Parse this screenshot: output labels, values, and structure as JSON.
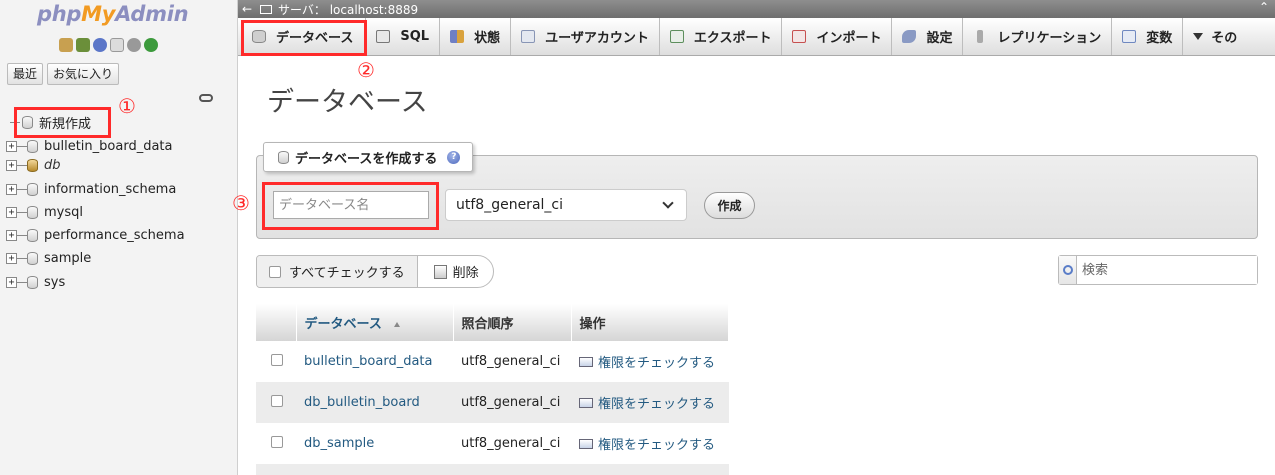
{
  "nav": {
    "logo": {
      "php": "php",
      "my": "My",
      "admin": "Admin"
    },
    "icons": [
      "home-icon",
      "logout-icon",
      "help-icon",
      "docs-icon",
      "settings-icon",
      "reload-icon"
    ],
    "tabs": {
      "recent": "最近",
      "favorites": "お気に入り"
    },
    "new_item": "新規作成",
    "databases": [
      {
        "name": "bulletin_board_data",
        "italic": false
      },
      {
        "name": "db",
        "italic": true
      },
      {
        "name": "information_schema",
        "italic": false
      },
      {
        "name": "mysql",
        "italic": false
      },
      {
        "name": "performance_schema",
        "italic": false
      },
      {
        "name": "sample",
        "italic": false
      },
      {
        "name": "sys",
        "italic": false
      }
    ]
  },
  "topbar": {
    "back": "←",
    "server_label": "サーバ： localhost:8889",
    "collapse": "⌃"
  },
  "menu": [
    {
      "label": "データベース",
      "icon": "database-icon",
      "color": "#c9c9c9"
    },
    {
      "label": "SQL",
      "icon": "sql-icon",
      "color": "#c9c9c9"
    },
    {
      "label": "状態",
      "icon": "status-icon",
      "color": "#7a87c8"
    },
    {
      "label": "ユーザアカウント",
      "icon": "users-icon",
      "color": "#9aa7c7"
    },
    {
      "label": "エクスポート",
      "icon": "export-icon",
      "color": "#5d8f5d"
    },
    {
      "label": "インポート",
      "icon": "import-icon",
      "color": "#c65050"
    },
    {
      "label": "設定",
      "icon": "wrench-icon",
      "color": "#7a8ab8"
    },
    {
      "label": "レプリケーション",
      "icon": "replication-icon",
      "color": "#999999"
    },
    {
      "label": "変数",
      "icon": "variables-icon",
      "color": "#6f88c0"
    },
    {
      "label": "その",
      "icon": "more-icon",
      "color": "#333333"
    }
  ],
  "main": {
    "title": "データベース",
    "create": {
      "legend": "データベースを作成する",
      "help": "?",
      "name_placeholder": "データベース名",
      "collation": "utf8_general_ci",
      "button": "作成"
    },
    "check_all": "すべてチェックする",
    "delete": "削除",
    "search_placeholder": "検索",
    "table": {
      "headers": [
        "データベース",
        "照合順序",
        "操作"
      ],
      "rows": [
        {
          "name": "bulletin_board_data",
          "collation": "utf8_general_ci",
          "action": "権限をチェックする"
        },
        {
          "name": "db_bulletin_board",
          "collation": "utf8_general_ci",
          "action": "権限をチェックする"
        },
        {
          "name": "db_sample",
          "collation": "utf8_general_ci",
          "action": "権限をチェックする"
        }
      ]
    }
  },
  "annotations": [
    "①",
    "②",
    "③"
  ],
  "colors": {
    "annotation": "#ff2a2a",
    "link": "#235a81"
  }
}
